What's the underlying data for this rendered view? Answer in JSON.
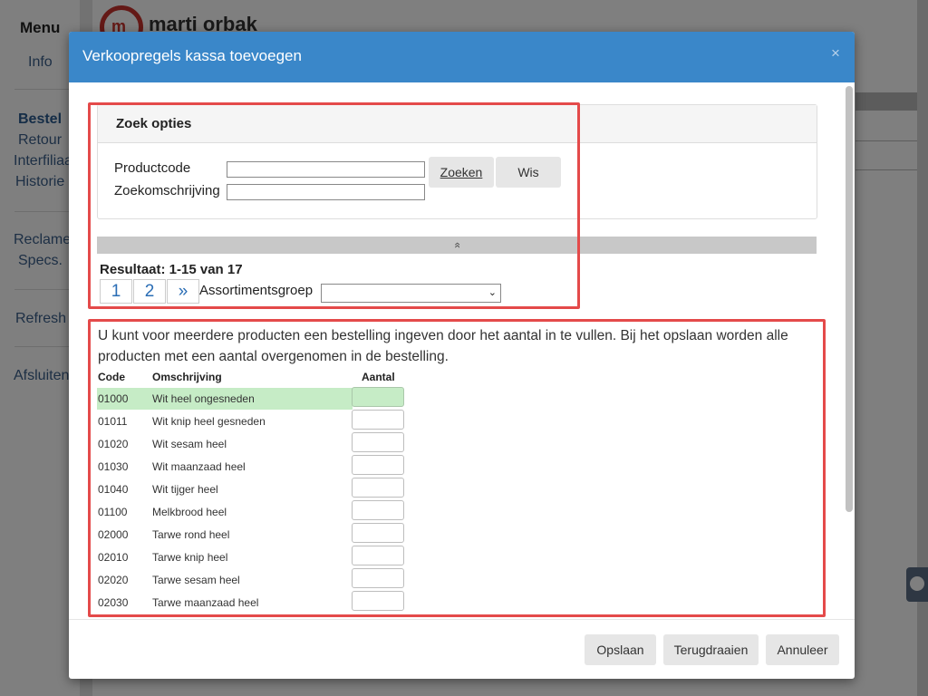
{
  "background": {
    "sidebar": {
      "menu_title": "Menu",
      "items": [
        "Info",
        "Bestel",
        "Retour",
        "Interfiliaal",
        "Historie",
        "Reclame",
        "Specs.",
        "Refresh",
        "Afsluiten"
      ]
    },
    "brand": "marti orbak",
    "logo_glyph": "m"
  },
  "modal": {
    "title": "Verkoopregels kassa toevoegen",
    "close_glyph": "×",
    "search": {
      "title": "Zoek opties",
      "productcode_label": "Productcode",
      "omschrijving_label": "Zoekomschrijving",
      "zoeken_label": "Zoeken",
      "wis_label": "Wis",
      "collapse_icon": "»"
    },
    "result_text": "Resultaat: 1-15 van 17",
    "pagination": [
      "1",
      "2",
      "»"
    ],
    "assortiment_label": "Assortimentsgroep",
    "assortiment_value": "",
    "info_text": "U kunt voor meerdere producten een bestelling ingeven door het aantal in te vullen. Bij het opslaan worden alle producten met een aantal overgenomen in de bestelling.",
    "table": {
      "headers": [
        "Code",
        "Omschrijving",
        "Aantal"
      ],
      "rows": [
        {
          "code": "01000",
          "desc": "Wit heel ongesneden",
          "qty": ""
        },
        {
          "code": "01011",
          "desc": "Wit knip heel gesneden",
          "qty": ""
        },
        {
          "code": "01020",
          "desc": "Wit sesam heel",
          "qty": ""
        },
        {
          "code": "01030",
          "desc": "Wit maanzaad heel",
          "qty": ""
        },
        {
          "code": "01040",
          "desc": "Wit tijger heel",
          "qty": ""
        },
        {
          "code": "01100",
          "desc": "Melkbrood heel",
          "qty": ""
        },
        {
          "code": "02000",
          "desc": "Tarwe rond heel",
          "qty": ""
        },
        {
          "code": "02010",
          "desc": "Tarwe knip heel",
          "qty": ""
        },
        {
          "code": "02020",
          "desc": "Tarwe sesam heel",
          "qty": ""
        },
        {
          "code": "02030",
          "desc": "Tarwe maanzaad heel",
          "qty": ""
        }
      ]
    },
    "footer": {
      "save_label": "Opslaan",
      "undo_label": "Terugdraaien",
      "cancel_label": "Annuleer"
    }
  },
  "colors": {
    "header_blue": "#3a87c9",
    "selected_row": "#c6ecc6",
    "highlight_red": "#e44a4a",
    "link_blue": "#2a6db5"
  }
}
